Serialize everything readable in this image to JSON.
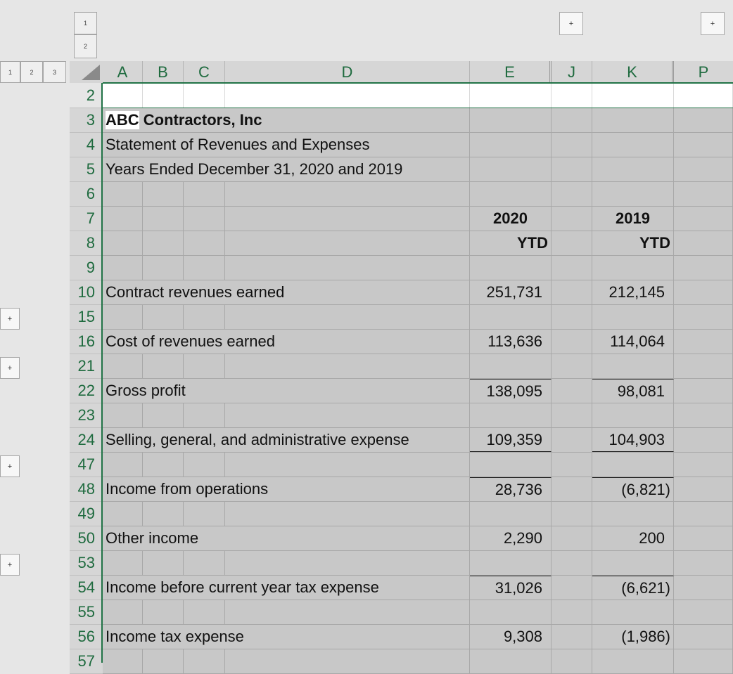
{
  "outline": {
    "column_levels": [
      "1",
      "2"
    ],
    "row_levels": [
      "1",
      "2",
      "3"
    ],
    "expand_symbol": "+"
  },
  "columns": [
    "A",
    "B",
    "C",
    "D",
    "E",
    "J",
    "K",
    "P"
  ],
  "rows": [
    {
      "num": "2",
      "a": "",
      "e": "",
      "k": ""
    },
    {
      "num": "3",
      "a_prefix": "ABC",
      "a": "Contractors, Inc",
      "e": "",
      "k": ""
    },
    {
      "num": "4",
      "a": "Statement of Revenues and Expenses",
      "e": "",
      "k": ""
    },
    {
      "num": "5",
      "a": "Years Ended December 31, 2020 and 2019",
      "e": "",
      "k": ""
    },
    {
      "num": "6",
      "a": "",
      "e": "",
      "k": ""
    },
    {
      "num": "7",
      "a": "",
      "e": "2020",
      "k": "2019"
    },
    {
      "num": "8",
      "a": "",
      "e": "YTD",
      "k": "YTD"
    },
    {
      "num": "9",
      "a": "",
      "e": "",
      "k": ""
    },
    {
      "num": "10",
      "a": "Contract revenues earned",
      "e": "251,731",
      "k": "212,145"
    },
    {
      "num": "15",
      "a": "",
      "e": "",
      "k": ""
    },
    {
      "num": "16",
      "a": "Cost of revenues earned",
      "e": "113,636",
      "k": "114,064"
    },
    {
      "num": "21",
      "a": "",
      "e": "",
      "k": ""
    },
    {
      "num": "22",
      "a": "Gross profit",
      "e": "138,095",
      "k": "98,081"
    },
    {
      "num": "23",
      "a": "",
      "e": "",
      "k": ""
    },
    {
      "num": "24",
      "a": "Selling, general, and administrative expense",
      "e": "109,359",
      "k": "104,903"
    },
    {
      "num": "47",
      "a": "",
      "e": "",
      "k": ""
    },
    {
      "num": "48",
      "a": "Income from operations",
      "e": "28,736",
      "k": "(6,821)"
    },
    {
      "num": "49",
      "a": "",
      "e": "",
      "k": ""
    },
    {
      "num": "50",
      "a": "Other income",
      "e": "2,290",
      "k": "200"
    },
    {
      "num": "53",
      "a": "",
      "e": "",
      "k": ""
    },
    {
      "num": "54",
      "a": "Income before current year tax expense",
      "e": "31,026",
      "k": "(6,621)"
    },
    {
      "num": "55",
      "a": "",
      "e": "",
      "k": ""
    },
    {
      "num": "56",
      "a": "Income tax expense",
      "e": "9,308",
      "k": "(1,986)"
    },
    {
      "num": "57",
      "a": "",
      "e": "",
      "k": ""
    }
  ],
  "colors": {
    "grid": "#c8c8c8",
    "header_text": "#1f6b3f",
    "selection_border": "#217346"
  }
}
